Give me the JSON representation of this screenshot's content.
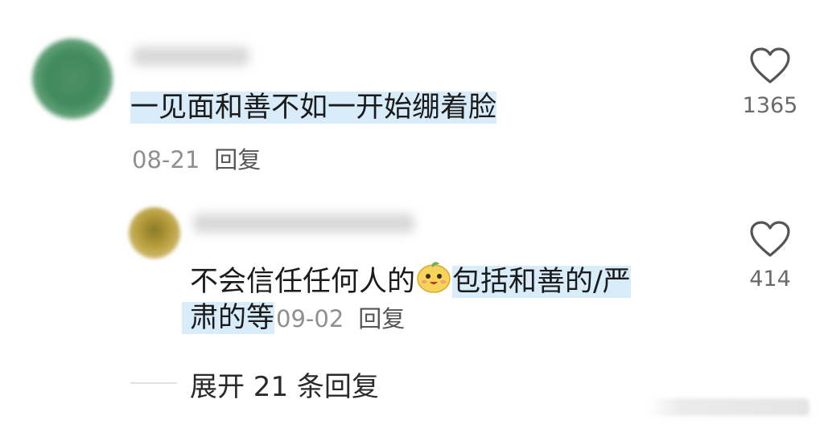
{
  "comment": {
    "text": "一见面和善不如一开始绷着脸",
    "date": "08-21",
    "reply_label": "回复",
    "like_count": "1365"
  },
  "reply": {
    "text_plain": "不会信任任何人的",
    "text_highlight_1": "包括和善的/严",
    "text_highlight_2": "肃的等",
    "date": "09-02",
    "reply_label": "回复",
    "like_count": "414",
    "emoji_icon": "smiling-bun-emoji"
  },
  "expand_replies": "展开 21 条回复",
  "colors": {
    "highlight": "#d8ecfa",
    "meta_text": "#8f8f8f",
    "main_text": "#1b1b1b"
  }
}
